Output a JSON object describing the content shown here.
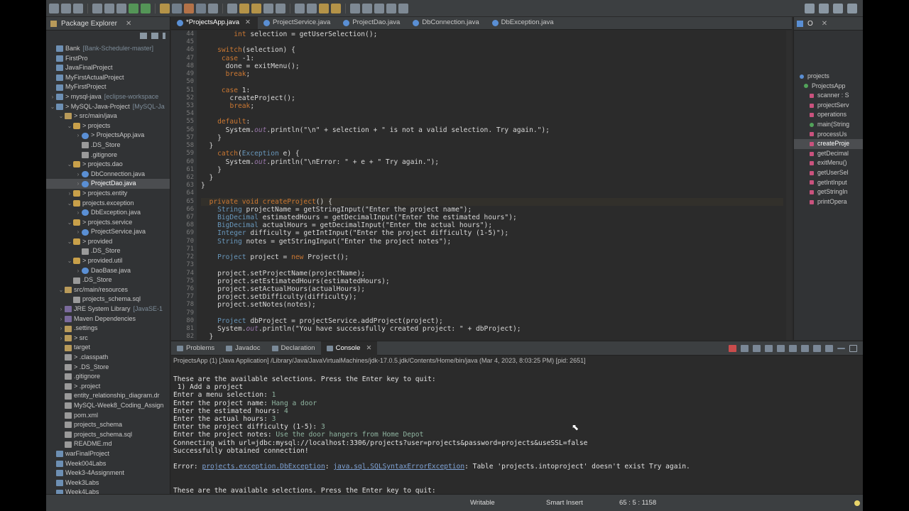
{
  "explorer": {
    "title": "Package Explorer",
    "items": [
      {
        "indent": 0,
        "tw": "",
        "icon": "proj",
        "label": "Bank",
        "dec": "[Bank-Scheduler-master]"
      },
      {
        "indent": 0,
        "tw": "",
        "icon": "proj",
        "label": "FirstPro",
        "dec": ""
      },
      {
        "indent": 0,
        "tw": "",
        "icon": "proj",
        "label": "JavaFinalProject",
        "dec": ""
      },
      {
        "indent": 0,
        "tw": "",
        "icon": "proj",
        "label": "MyFirstActualProject",
        "dec": ""
      },
      {
        "indent": 0,
        "tw": "",
        "icon": "proj",
        "label": "MyFirstProject",
        "dec": ""
      },
      {
        "indent": 0,
        "tw": ">",
        "icon": "proj",
        "label": "> mysql-java",
        "dec": "[eclipse-workspace"
      },
      {
        "indent": 0,
        "tw": "v",
        "icon": "proj",
        "label": "> MySQL-Java-Project",
        "dec": "[MySQL-Ja"
      },
      {
        "indent": 1,
        "tw": "v",
        "icon": "folder",
        "label": "> src/main/java",
        "dec": ""
      },
      {
        "indent": 2,
        "tw": "v",
        "icon": "pkg",
        "label": "> projects",
        "dec": ""
      },
      {
        "indent": 3,
        "tw": ">",
        "icon": "java",
        "label": "> ProjectsApp.java",
        "dec": ""
      },
      {
        "indent": 3,
        "tw": "",
        "icon": "file",
        "label": ".DS_Store",
        "dec": ""
      },
      {
        "indent": 3,
        "tw": "",
        "icon": "file",
        "label": ".gitignore",
        "dec": ""
      },
      {
        "indent": 2,
        "tw": "v",
        "icon": "pkg",
        "label": "> projects.dao",
        "dec": ""
      },
      {
        "indent": 3,
        "tw": ">",
        "icon": "java",
        "label": "DbConnection.java",
        "dec": ""
      },
      {
        "indent": 3,
        "tw": ">",
        "icon": "java",
        "label": "ProjectDao.java",
        "dec": "",
        "sel": true
      },
      {
        "indent": 2,
        "tw": ">",
        "icon": "pkg",
        "label": "> projects.entity",
        "dec": ""
      },
      {
        "indent": 2,
        "tw": "v",
        "icon": "pkg",
        "label": "projects.exception",
        "dec": ""
      },
      {
        "indent": 3,
        "tw": ">",
        "icon": "java",
        "label": "DbException.java",
        "dec": ""
      },
      {
        "indent": 2,
        "tw": "v",
        "icon": "pkg",
        "label": "> projects.service",
        "dec": ""
      },
      {
        "indent": 3,
        "tw": ">",
        "icon": "java",
        "label": "ProjectService.java",
        "dec": ""
      },
      {
        "indent": 2,
        "tw": "v",
        "icon": "pkg",
        "label": "> provided",
        "dec": ""
      },
      {
        "indent": 3,
        "tw": "",
        "icon": "file",
        "label": ".DS_Store",
        "dec": ""
      },
      {
        "indent": 2,
        "tw": "v",
        "icon": "pkg",
        "label": "> provided.util",
        "dec": ""
      },
      {
        "indent": 3,
        "tw": ">",
        "icon": "java",
        "label": "DaoBase.java",
        "dec": ""
      },
      {
        "indent": 2,
        "tw": "",
        "icon": "file",
        "label": ".DS_Store",
        "dec": ""
      },
      {
        "indent": 1,
        "tw": "v",
        "icon": "folder",
        "label": "src/main/resources",
        "dec": ""
      },
      {
        "indent": 2,
        "tw": "",
        "icon": "file",
        "label": "projects_schema.sql",
        "dec": ""
      },
      {
        "indent": 1,
        "tw": ">",
        "icon": "lib",
        "label": "JRE System Library",
        "dec": "[JavaSE-1"
      },
      {
        "indent": 1,
        "tw": ">",
        "icon": "lib",
        "label": "Maven Dependencies",
        "dec": ""
      },
      {
        "indent": 1,
        "tw": ">",
        "icon": "folder",
        "label": ".settings",
        "dec": ""
      },
      {
        "indent": 1,
        "tw": ">",
        "icon": "folder",
        "label": "> src",
        "dec": ""
      },
      {
        "indent": 1,
        "tw": "",
        "icon": "folder",
        "label": "target",
        "dec": ""
      },
      {
        "indent": 1,
        "tw": "",
        "icon": "file",
        "label": "> .classpath",
        "dec": ""
      },
      {
        "indent": 1,
        "tw": "",
        "icon": "file",
        "label": "> .DS_Store",
        "dec": ""
      },
      {
        "indent": 1,
        "tw": "",
        "icon": "file",
        "label": ".gitignore",
        "dec": ""
      },
      {
        "indent": 1,
        "tw": "",
        "icon": "file",
        "label": "> .project",
        "dec": ""
      },
      {
        "indent": 1,
        "tw": "",
        "icon": "file",
        "label": "entity_relationship_diagram.dr",
        "dec": ""
      },
      {
        "indent": 1,
        "tw": "",
        "icon": "file",
        "label": "MySQL-Week8_Coding_Assign",
        "dec": ""
      },
      {
        "indent": 1,
        "tw": "",
        "icon": "file",
        "label": "pom.xml",
        "dec": ""
      },
      {
        "indent": 1,
        "tw": "",
        "icon": "file",
        "label": "projects_schema",
        "dec": ""
      },
      {
        "indent": 1,
        "tw": "",
        "icon": "file",
        "label": "projects_schema.sql",
        "dec": ""
      },
      {
        "indent": 1,
        "tw": "",
        "icon": "file",
        "label": "README.md",
        "dec": ""
      },
      {
        "indent": 0,
        "tw": "",
        "icon": "proj",
        "label": "warFinalProject",
        "dec": ""
      },
      {
        "indent": 0,
        "tw": "",
        "icon": "proj",
        "label": "Week004Labs",
        "dec": ""
      },
      {
        "indent": 0,
        "tw": "",
        "icon": "proj",
        "label": "Week3-4Assignment",
        "dec": ""
      },
      {
        "indent": 0,
        "tw": "",
        "icon": "proj",
        "label": "Week3Labs",
        "dec": ""
      },
      {
        "indent": 0,
        "tw": "",
        "icon": "proj",
        "label": "Week4Labs",
        "dec": ""
      },
      {
        "indent": 0,
        "tw": "",
        "icon": "proj",
        "label": "week5Assignment",
        "dec": ""
      }
    ]
  },
  "editor": {
    "tabs": [
      {
        "label": "*ProjectsApp.java",
        "active": true
      },
      {
        "label": "ProjectService.java",
        "active": false
      },
      {
        "label": "ProjectDao.java",
        "active": false
      },
      {
        "label": "DbConnection.java",
        "active": false
      },
      {
        "label": "DbException.java",
        "active": false
      }
    ],
    "line_numbers": [
      "44",
      "45",
      "46",
      "47",
      "48",
      "49",
      "50",
      "51",
      "52",
      "53",
      "54",
      "55",
      "56",
      "57",
      "58",
      "59",
      "60",
      "61",
      "62",
      "63",
      "64",
      "65",
      "66",
      "67",
      "68",
      "69",
      "70",
      "71",
      "72",
      "73",
      "74",
      "75",
      "76",
      "77",
      "78",
      "79",
      "80",
      "81",
      "82"
    ],
    "current_line_index": 21,
    "lines": [
      [
        [
          "        ",
          "st"
        ],
        [
          "int",
          "kw"
        ],
        [
          " selection = getUserSelection();",
          "st"
        ]
      ],
      [
        [
          "",
          ""
        ]
      ],
      [
        [
          "    switch",
          "kw"
        ],
        [
          "(selection) {",
          "st"
        ]
      ],
      [
        [
          "     ",
          "st"
        ],
        [
          "case",
          "kw"
        ],
        [
          " -1:",
          "st"
        ]
      ],
      [
        [
          "      done = exitMenu();",
          "st"
        ]
      ],
      [
        [
          "      ",
          "st"
        ],
        [
          "break",
          "kw"
        ],
        [
          ";",
          "st"
        ]
      ],
      [
        [
          "",
          ""
        ]
      ],
      [
        [
          "     ",
          "st"
        ],
        [
          "case",
          "kw"
        ],
        [
          " 1:",
          "st"
        ]
      ],
      [
        [
          "       createProject();",
          "st"
        ]
      ],
      [
        [
          "       ",
          "st"
        ],
        [
          "break",
          "kw"
        ],
        [
          ";",
          "st"
        ]
      ],
      [
        [
          "",
          ""
        ]
      ],
      [
        [
          "    ",
          "st"
        ],
        [
          "default",
          "kw"
        ],
        [
          ":",
          "st"
        ]
      ],
      [
        [
          "      System.",
          "st"
        ],
        [
          "out",
          "fi"
        ],
        [
          ".println(\"\\n\" + selection + \" is not a valid selection. Try again.\");",
          "st"
        ]
      ],
      [
        [
          "    }",
          "st"
        ]
      ],
      [
        [
          "  }",
          "st"
        ]
      ],
      [
        [
          "    ",
          "st"
        ],
        [
          "catch",
          "kw"
        ],
        [
          "(",
          "st"
        ],
        [
          "Exception",
          "ty"
        ],
        [
          " e) {",
          "st"
        ]
      ],
      [
        [
          "      System.",
          "st"
        ],
        [
          "out",
          "fi"
        ],
        [
          ".println(\"\\nError: \" + e + \" Try again.\");",
          "st"
        ]
      ],
      [
        [
          "    }",
          "st"
        ]
      ],
      [
        [
          "  }",
          "st"
        ]
      ],
      [
        [
          "}",
          "st"
        ]
      ],
      [
        [
          "",
          ""
        ]
      ],
      [
        [
          "  ",
          "st"
        ],
        [
          "private void",
          "kw"
        ],
        [
          " ",
          "st"
        ],
        [
          "createProject",
          "kw"
        ],
        [
          "() {",
          "st"
        ]
      ],
      [
        [
          "    ",
          "st"
        ],
        [
          "String",
          "ty"
        ],
        [
          " projectName = getStringInput(\"Enter the project name\");",
          "st"
        ]
      ],
      [
        [
          "    ",
          "st"
        ],
        [
          "BigDecimal",
          "ty"
        ],
        [
          " estimatedHours = getDecimalInput(\"Enter the estimated hours\");",
          "st"
        ]
      ],
      [
        [
          "    ",
          "st"
        ],
        [
          "BigDecimal",
          "ty"
        ],
        [
          " actualHours = getDecimalInput(\"Enter the actual hours\");",
          "st"
        ]
      ],
      [
        [
          "    ",
          "st"
        ],
        [
          "Integer",
          "ty"
        ],
        [
          " difficulty = getIntInput(\"Enter the project difficulty (1-5)\");",
          "st"
        ]
      ],
      [
        [
          "    ",
          "st"
        ],
        [
          "String",
          "ty"
        ],
        [
          " notes = getStringInput(\"Enter the project notes\");",
          "st"
        ]
      ],
      [
        [
          "",
          ""
        ]
      ],
      [
        [
          "    ",
          "st"
        ],
        [
          "Project",
          "ty"
        ],
        [
          " project = ",
          "st"
        ],
        [
          "new",
          "kw"
        ],
        [
          " Project();",
          "st"
        ]
      ],
      [
        [
          "",
          ""
        ]
      ],
      [
        [
          "    project.setProjectName(projectName);",
          "st"
        ]
      ],
      [
        [
          "    project.setEstimatedHours(estimatedHours);",
          "st"
        ]
      ],
      [
        [
          "    project.setActualHours(actualHours);",
          "st"
        ]
      ],
      [
        [
          "    project.setDifficulty(difficulty);",
          "st"
        ]
      ],
      [
        [
          "    project.setNotes(notes);",
          "st"
        ]
      ],
      [
        [
          "",
          ""
        ]
      ],
      [
        [
          "    ",
          "st"
        ],
        [
          "Project",
          "ty"
        ],
        [
          " dbProject = projectService.addProject(project);",
          "st"
        ]
      ],
      [
        [
          "    System.",
          "st"
        ],
        [
          "out",
          "fi"
        ],
        [
          ".println(\"You have successfully created project: \" + dbProject);",
          "st"
        ]
      ],
      [
        [
          "  }",
          "st"
        ]
      ]
    ]
  },
  "outline": {
    "title": "O",
    "items": [
      {
        "label": "projects",
        "kind": "pkg",
        "sel": false
      },
      {
        "label": "ProjectsApp",
        "kind": "green",
        "sel": false
      },
      {
        "label": "scanner : S",
        "kind": "red",
        "sel": false
      },
      {
        "label": "projectServ",
        "kind": "red",
        "sel": false
      },
      {
        "label": "operations",
        "kind": "red",
        "sel": false
      },
      {
        "label": "main(String",
        "kind": "green",
        "sel": false
      },
      {
        "label": "processUs",
        "kind": "red",
        "sel": false
      },
      {
        "label": "createProje",
        "kind": "red",
        "sel": true
      },
      {
        "label": "getDecimal",
        "kind": "red",
        "sel": false
      },
      {
        "label": "exitMenu()",
        "kind": "red",
        "sel": false
      },
      {
        "label": "getUserSel",
        "kind": "red",
        "sel": false
      },
      {
        "label": "getIntInput",
        "kind": "red",
        "sel": false
      },
      {
        "label": "getStringIn",
        "kind": "red",
        "sel": false
      },
      {
        "label": "printOpera",
        "kind": "red",
        "sel": false
      }
    ]
  },
  "console": {
    "tabs": [
      {
        "label": "Problems",
        "active": false
      },
      {
        "label": "Javadoc",
        "active": false
      },
      {
        "label": "Declaration",
        "active": false
      },
      {
        "label": "Console",
        "active": true
      }
    ],
    "process": "ProjectsApp (1) [Java Application] /Library/Java/JavaVirtualMachines/jdk-17.0.5.jdk/Contents/Home/bin/java  (Mar 4, 2023, 8:03:25 PM) [pid: 2651]",
    "lines": [
      [
        [
          "These are the available selections. Press the Enter key to quit:",
          ""
        ]
      ],
      [
        [
          " 1) Add a project",
          ""
        ]
      ],
      [
        [
          "Enter a menu selection: ",
          ""
        ],
        [
          "1",
          "in"
        ]
      ],
      [
        [
          "Enter the project name: ",
          ""
        ],
        [
          "Hang a door",
          "in"
        ]
      ],
      [
        [
          "Enter the estimated hours: ",
          ""
        ],
        [
          "4",
          "in"
        ]
      ],
      [
        [
          "Enter the actual hours: ",
          ""
        ],
        [
          "3",
          "in"
        ]
      ],
      [
        [
          "Enter the project difficulty (1-5): ",
          ""
        ],
        [
          "3",
          "in"
        ]
      ],
      [
        [
          "Enter the project notes: ",
          ""
        ],
        [
          "Use the door hangers from Home Depot",
          "in"
        ]
      ],
      [
        [
          "Connecting with url=jdbc:mysql://localhost:3306/projects?user=projects&password=projects&useSSL=false",
          ""
        ]
      ],
      [
        [
          "Successfully obtained connection!",
          ""
        ]
      ],
      [
        [
          "",
          ""
        ]
      ],
      [
        [
          "Error: ",
          ""
        ],
        [
          "projects.exception.DbException",
          "lnk"
        ],
        [
          ": ",
          ""
        ],
        [
          "java.sql.SQLSyntaxErrorException",
          "lnk"
        ],
        [
          ": Table 'projects.intoproject' doesn't exist Try again.",
          ""
        ]
      ],
      [
        [
          "",
          ""
        ]
      ],
      [
        [
          "",
          ""
        ]
      ],
      [
        [
          "These are the available selections. Press the Enter key to quit:",
          ""
        ]
      ]
    ]
  },
  "status": {
    "writable": "Writable",
    "insert_mode": "Smart Insert",
    "position": "65 : 5 : 1158"
  }
}
